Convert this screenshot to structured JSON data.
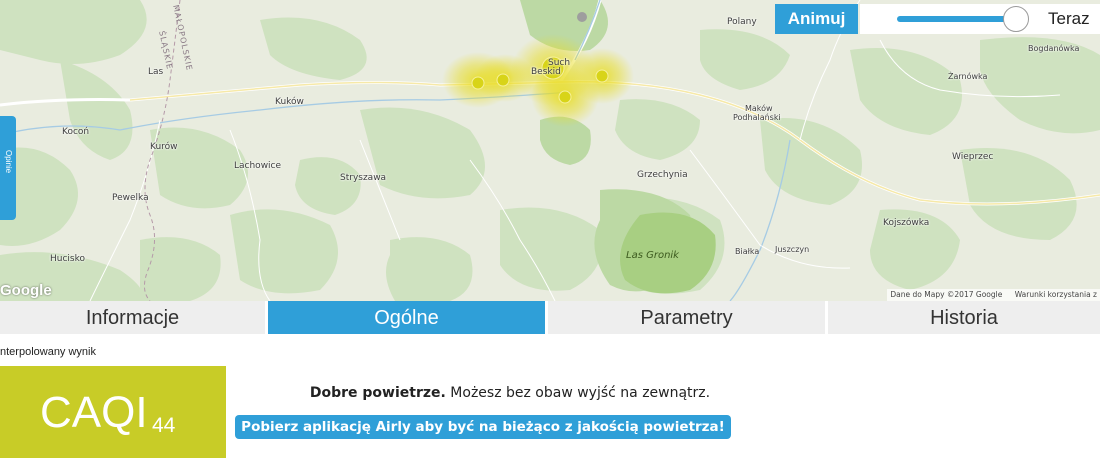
{
  "map": {
    "places": {
      "polany": "Polany",
      "bogdanowka": "Bogdanówka",
      "zarnowka": "Żarnówka",
      "las": "Las",
      "kukow": "Kuków",
      "maków": "Maków",
      "podhalanski": "Podhalański",
      "kocon": "Kocoń",
      "kurow": "Kurów",
      "wieprzec": "Wieprzec",
      "lachowice": "Lachowice",
      "stryszawa": "Stryszawa",
      "grzechynia": "Grzechynia",
      "pewelka": "Pewelka",
      "kojszowka": "Kojszówka",
      "bialka": "Białka",
      "juszczyn": "Juszczyn",
      "hucisko": "Hucisko",
      "sucha1": "Such",
      "sucha2": "Beskid",
      "region_malopolskie": "MAŁOPOLSKIE",
      "region_slaskie": "ŚLĄSKIE"
    },
    "park": "Las Gronik",
    "google_logo": "Google",
    "attribution": "Dane do Mapy ©2017 Google",
    "terms": "Warunki korzystania z",
    "side_tab": "Opinie"
  },
  "controls": {
    "animate_button": "Animuj",
    "slider_level": 1.0,
    "slider_label": "Teraz"
  },
  "tabs": [
    "Informacje",
    "Ogólne",
    "Parametry",
    "Historia"
  ],
  "active_tab": "Ogólne",
  "result": {
    "interpolated_label": "nterpolowany wynik",
    "caqi_label": "CAQI",
    "caqi_value": "44",
    "caqi_color": "#c8cc27",
    "verdict_bold": "Dobre powietrze.",
    "verdict_text": " Możesz bez obaw wyjść na zewnątrz.",
    "app_banner": "Pobierz aplikację Airly aby być na bieżąco z jakością powietrza!"
  },
  "colors": {
    "accent": "#2f9fd8",
    "sensor_marker": "#d8d418"
  }
}
